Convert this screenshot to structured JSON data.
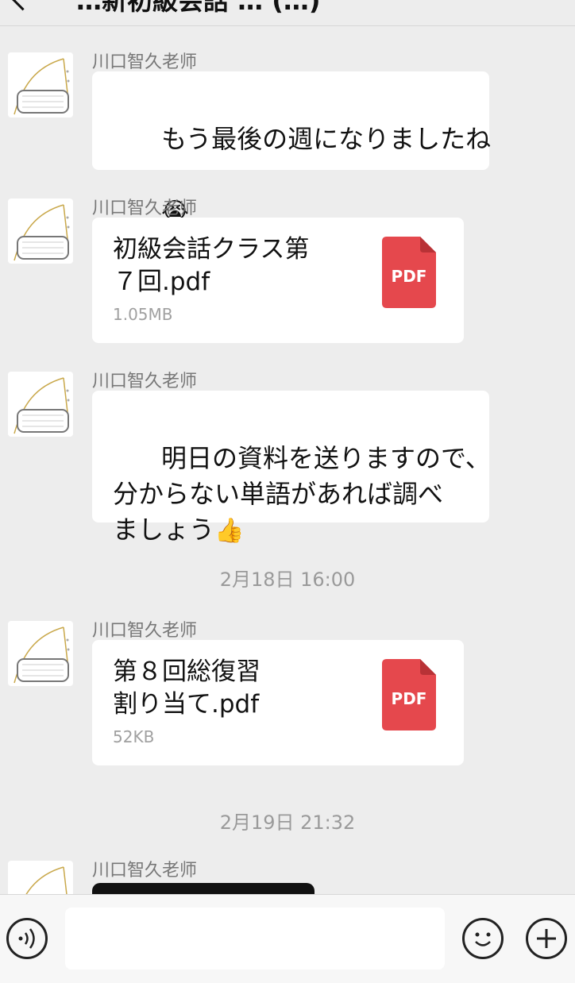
{
  "header": {
    "title": "…新初級会話 … (…)",
    "back_icon": "chevron-left-icon"
  },
  "messages": [
    {
      "sender": "川口智久老师",
      "text": "もう最後の週になりましたね",
      "emoji": "😭"
    },
    {
      "sender": "川口智久老师",
      "file_name": "初級会話クラス第\n７回.pdf",
      "file_size": "1.05MB",
      "file_icon": "PDF"
    },
    {
      "sender": "川口智久老师",
      "text": "明日の資料を送りますので、\n分からない単語があれば調べ\nましょう",
      "emoji": "👍"
    },
    {
      "timestamp": "2月18日 16:00"
    },
    {
      "sender": "川口智久老师",
      "file_name": "第８回総復習\n割り当て.pdf",
      "file_size": "52KB",
      "file_icon": "PDF"
    },
    {
      "timestamp": "2月19日 21:32"
    },
    {
      "sender": "川口智久老师"
    }
  ],
  "input": {
    "value": "",
    "voice_icon": "voice-icon",
    "emoji_icon": "emoji-icon",
    "more_icon": "plus-icon"
  },
  "colors": {
    "background": "#ededed",
    "bubble": "#ffffff",
    "pdf": "#e5484d",
    "muted_text": "#9a9a9a"
  }
}
